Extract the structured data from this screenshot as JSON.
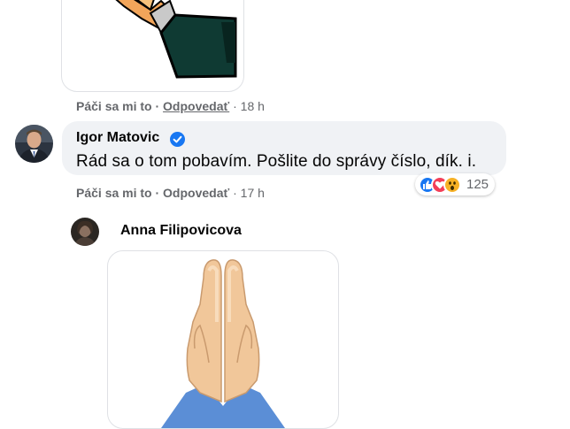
{
  "top_comment": {
    "actions": {
      "like": "Páči sa mi to",
      "sep": "·",
      "reply": "Odpovedať",
      "time": "18 h"
    }
  },
  "comment": {
    "author": "Igor Matovic",
    "text": "Rád sa o tom pobavím. Pošlite do správy číslo, dík. i.",
    "actions": {
      "like": "Páči sa mi to",
      "sep": "·",
      "reply": "Odpovedať",
      "time": "17 h"
    },
    "reactions": {
      "icons": [
        "like-icon",
        "love-icon",
        "wow-icon"
      ],
      "count": "125"
    }
  },
  "reply": {
    "author": "Anna Filipovicova"
  },
  "colors": {
    "like": "#1877f2",
    "love": "#f33e58",
    "wow": "#f7b125",
    "muted": "#65676b",
    "bubble": "#f0f2f5"
  }
}
